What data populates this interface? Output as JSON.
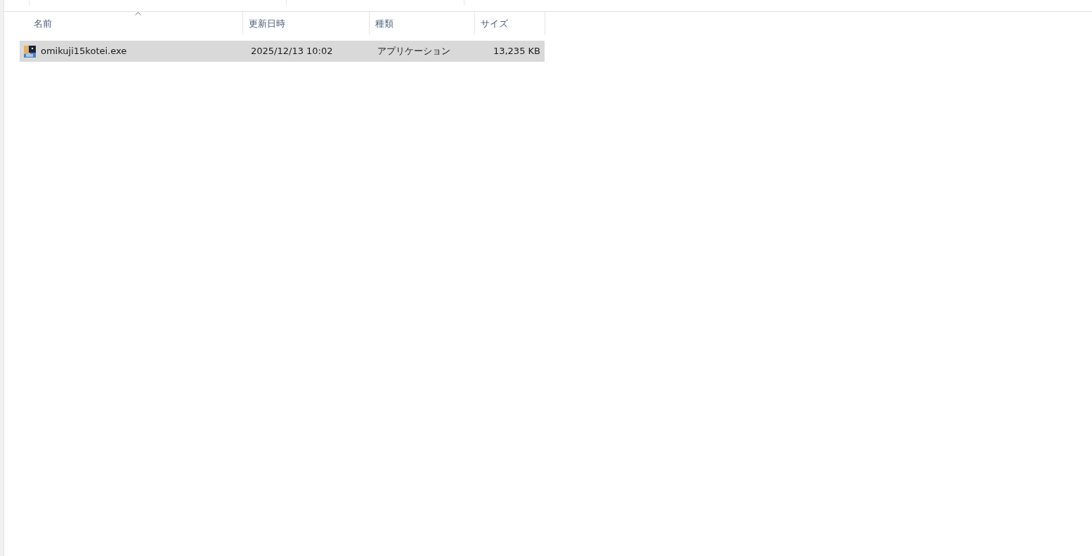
{
  "table": {
    "columns": [
      {
        "label": "名前",
        "sorted": true
      },
      {
        "label": "更新日時",
        "sorted": false
      },
      {
        "label": "種類",
        "sorted": false
      },
      {
        "label": "サイズ",
        "sorted": false
      }
    ],
    "rows": [
      {
        "name": "omikuji15kotei.exe",
        "modified": "2025/12/13 10:02",
        "type": "アプリケーション",
        "size": "13,235 KB",
        "selected": true
      }
    ]
  }
}
